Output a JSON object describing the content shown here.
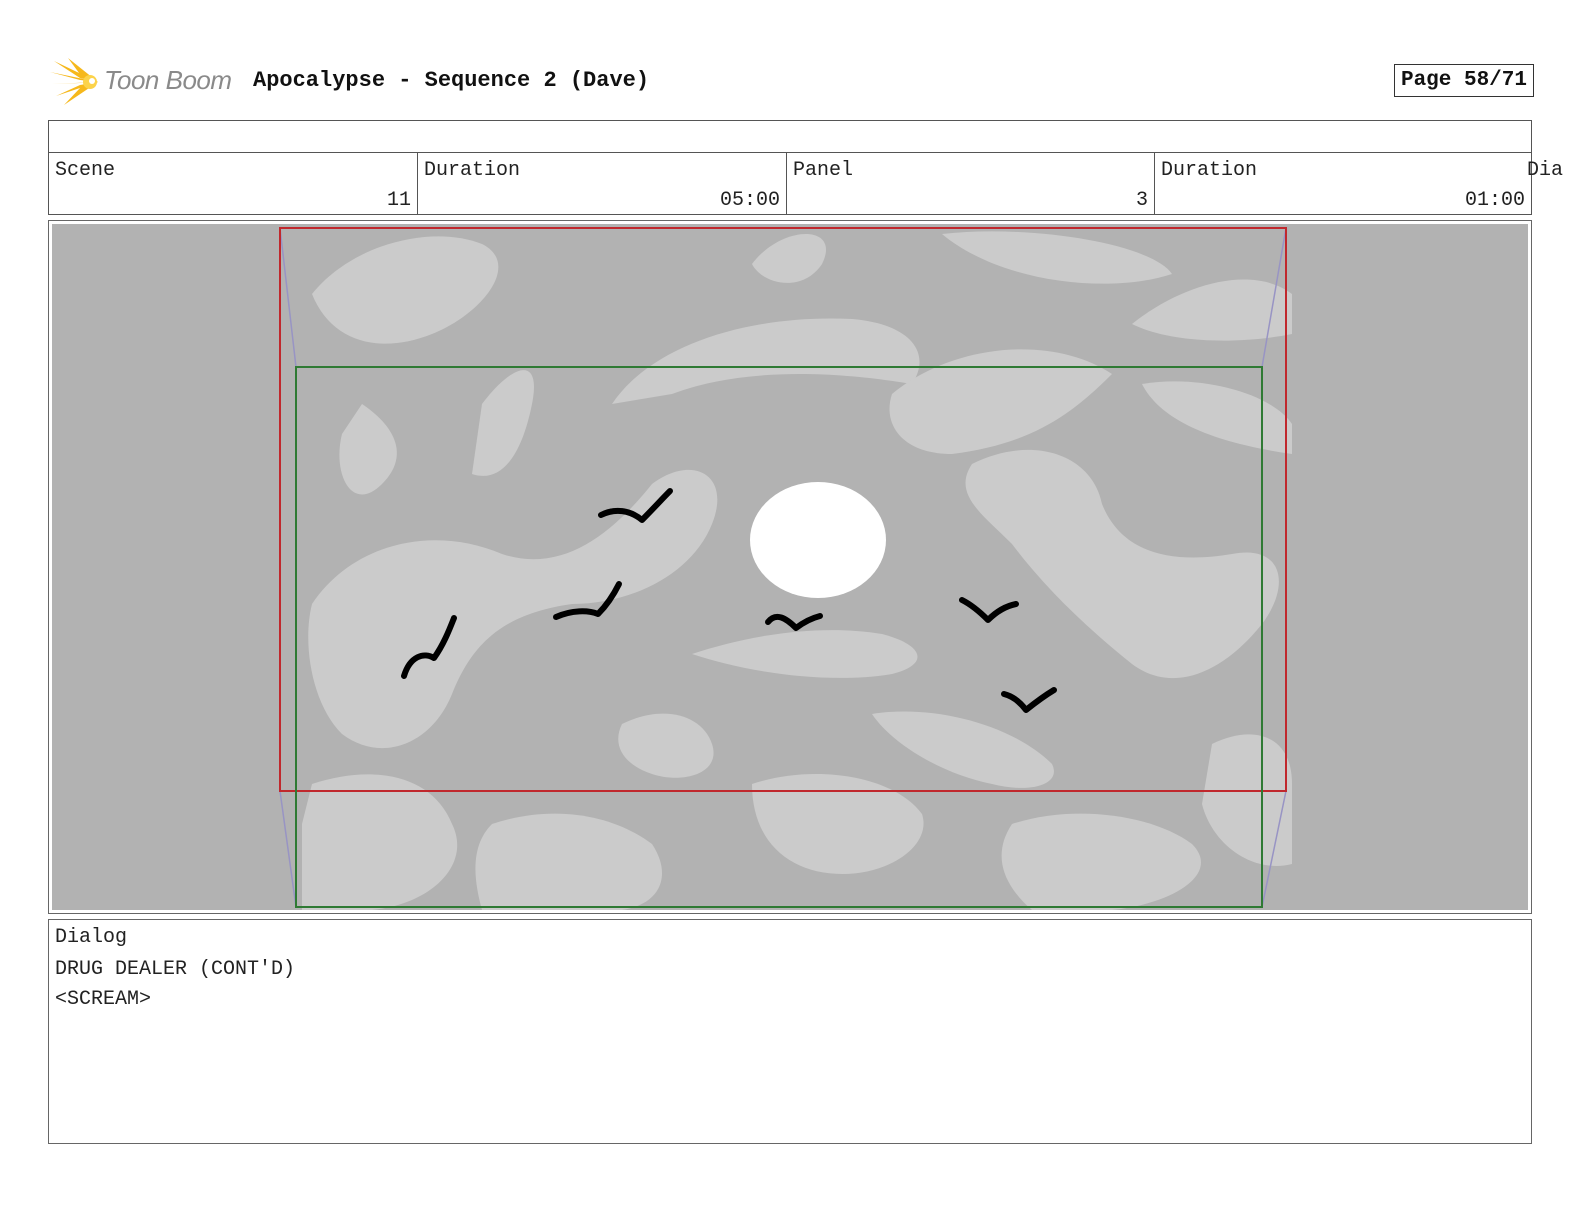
{
  "header": {
    "brand": "Toon Boom",
    "title": "Apocalypse - Sequence 2 (Dave)",
    "page": "Page 58/71"
  },
  "info": {
    "scene_label": "Scene",
    "scene_value": "11",
    "scene_duration_label": "Duration",
    "scene_duration_value": "05:00",
    "panel_label": "Panel",
    "panel_value": "3",
    "panel_duration_label": "Duration",
    "panel_duration_value": "01:00",
    "overflow_label": "Dia"
  },
  "dialog": {
    "label": "Dialog",
    "lines": [
      "DRUG DEALER (CONT'D)",
      "<SCREAM>"
    ]
  },
  "colors": {
    "sky_dark": "#b2b2b2",
    "sky_light": "#cbcbcb",
    "camera_frame": "#c0282d",
    "safe_frame": "#2f7a34",
    "sun": "#ffffff",
    "logo_star": "#f6b81b"
  }
}
